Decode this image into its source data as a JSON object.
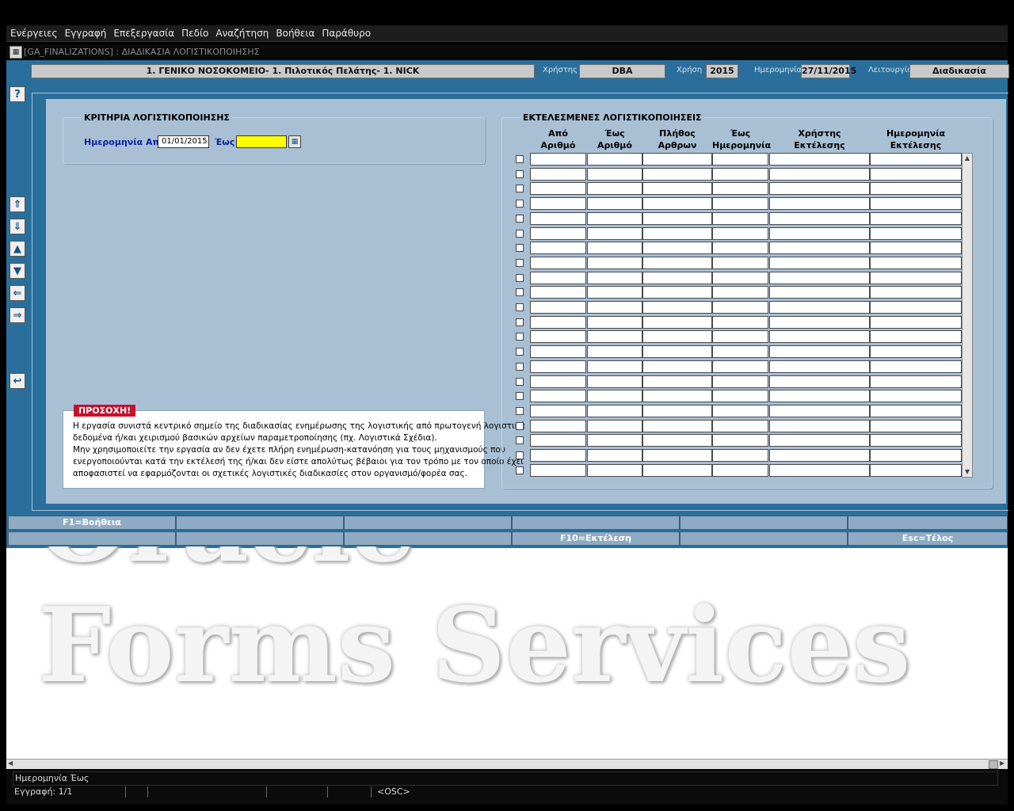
{
  "menu": [
    "Ενέργειες",
    "Εγγραφή",
    "Επεξεργασία",
    "Πεδίο",
    "Αναζήτηση",
    "Βοήθεια",
    "Παράθυρο"
  ],
  "window": {
    "title": "[GA_FINALIZATIONS]   :  ΔΙΑΔΙΚΑΣΙΑ ΛΟΓΙΣΤΙΚΟΠΟΙΗΣΗΣ"
  },
  "header": {
    "organization": "1. ΓΕΝΙΚΟ ΝΟΣΟΚΟΜΕΙΟ- 1. Πιλοτικός Πελάτης- 1. NICK",
    "user_label": "Χρήστης",
    "user": "DBA",
    "year_label": "Χρήση",
    "year": "2015",
    "date_label": "Ημερομηνία",
    "date": "27/11/2015",
    "function_label": "Λειτουργία",
    "function": "Διαδικασία"
  },
  "toolbar_icons": [
    "help-icon",
    "first-record-icon",
    "last-record-icon",
    "previous-record-icon",
    "next-record-icon",
    "previous-block-icon",
    "next-block-icon",
    "exit-icon"
  ],
  "criteria": {
    "title": "ΚΡΙΤΗΡΙΑ ΛΟΓΙΣΤΙΚΟΠΟΙΗΣΗΣ",
    "from_label": "Ημερομηνία Από",
    "from_value": "01/01/2015",
    "to_label": "Έως",
    "to_value": ""
  },
  "warning": {
    "tag": "ΠΡΟΣΟΧΗ!",
    "lines": [
      "Η εργασία συνιστά κεντρικό σημείο της διαδικασίας ενημέρωσης της λογιστικής από πρωτογενή λογιστικά",
      "δεδομένα ή/και χειρισμού βασικών αρχείων παραμετροποίησης (πχ. Λογιστικά Σχέδια).",
      "Μην χρησιμοποιείτε την εργασία αν δεν έχετε πλήρη ενημέρωση-κατανόηση για τους μηχανισμούς που",
      "ενεργοποιούνται κατά την εκτέλεσή της ή/και δεν είστε απολύτως βέβαιοι για τον τρόπο με τον οποίο έχει",
      "αποφασιστεί να εφαρμόζονται οι σχετικές λογιστικές διαδικασίες στον οργανισμό/φορέα σας."
    ]
  },
  "executions": {
    "title": "ΕΚΤΕΛΕΣΜΕΝΕΣ ΛΟΓΙΣΤΙΚΟΠΟΙΗΣΕΙΣ",
    "columns": [
      {
        "line1": "Από",
        "line2": "Αριθμό"
      },
      {
        "line1": "Έως",
        "line2": "Αριθμό"
      },
      {
        "line1": "Πλήθος",
        "line2": "Αρθρων"
      },
      {
        "line1": "Έως",
        "line2": "Ημερομηνία"
      },
      {
        "line1": "Χρήστης",
        "line2": "Εκτέλεσης"
      },
      {
        "line1": "Ημερομηνία",
        "line2": "Εκτέλεσης"
      }
    ],
    "row_count": 22
  },
  "function_keys": [
    [
      "F1=Βοήθεια",
      "",
      "",
      "",
      "",
      ""
    ],
    [
      "",
      "",
      "",
      "F10=Εκτέλεση",
      "",
      "Esc=Τέλος"
    ]
  ],
  "watermark": {
    "line1": "Oracle",
    "line2": "Forms Services"
  },
  "status": {
    "message": "Ημερομηνία Έως",
    "record": "Εγγραφή: 1/1",
    "mode": "<OSC>"
  },
  "colors": {
    "canvas": "#2a6f9b",
    "content": "#a8bfd4",
    "required_field": "#ffff00",
    "warning_tag": "#c8102e"
  }
}
